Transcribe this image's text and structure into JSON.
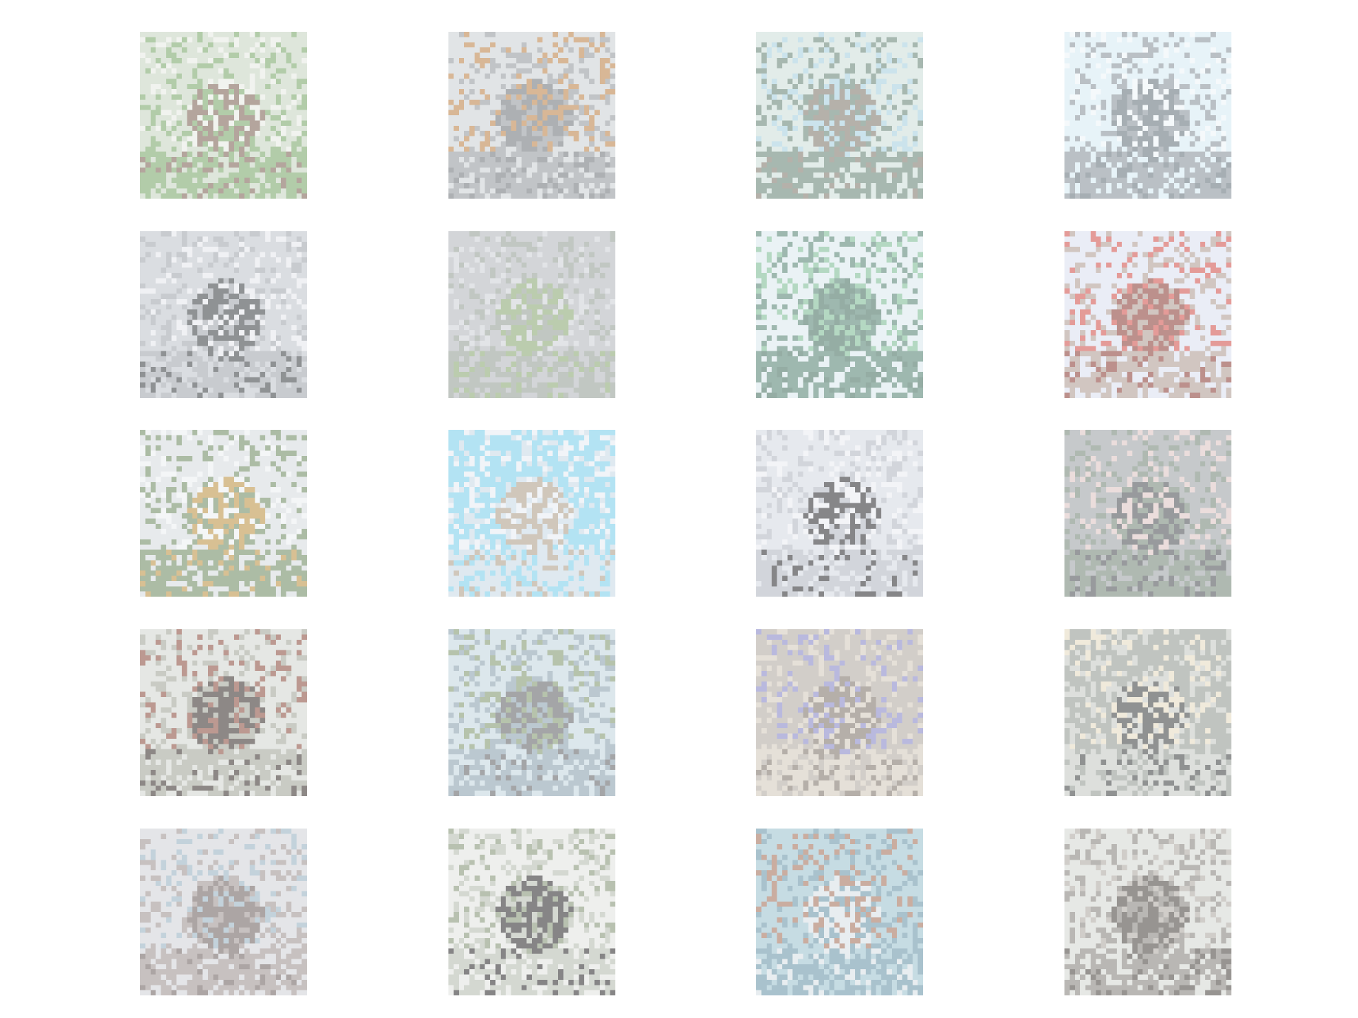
{
  "grid": {
    "rows": 5,
    "cols": 4,
    "images": [
      {
        "id": "img-r1c1",
        "subject": "deer",
        "colors": {
          "bg": "#c9d7c3",
          "mid": "#7fae6d",
          "fg": "#8a6f5e",
          "accent": "#e9ece6"
        }
      },
      {
        "id": "img-r1c2",
        "subject": "frog",
        "colors": {
          "bg": "#cfd3d8",
          "mid": "#9aa0a6",
          "fg": "#7b8087",
          "accent": "#c98a4b"
        }
      },
      {
        "id": "img-r1c3",
        "subject": "animal-by-water",
        "colors": {
          "bg": "#cfe0dc",
          "mid": "#6f8e7e",
          "fg": "#8a8274",
          "accent": "#a7d4e4"
        }
      },
      {
        "id": "img-r1c4",
        "subject": "bird",
        "colors": {
          "bg": "#d6ecf6",
          "mid": "#8e9aa4",
          "fg": "#6f7c87",
          "accent": "#eef5f8"
        }
      },
      {
        "id": "img-r2c1",
        "subject": "truck",
        "colors": {
          "bg": "#c4c8d0",
          "mid": "#a7abb3",
          "fg": "#4b4f55",
          "accent": "#e7e9ed"
        }
      },
      {
        "id": "img-r2c2",
        "subject": "frog",
        "colors": {
          "bg": "#b9bcc2",
          "mid": "#9aa59b",
          "fg": "#8fae77",
          "accent": "#d0d3d8"
        }
      },
      {
        "id": "img-r2c3",
        "subject": "ship",
        "colors": {
          "bg": "#dbeaf0",
          "mid": "#5c8f7f",
          "fg": "#4f7d6b",
          "accent": "#7fc49a"
        }
      },
      {
        "id": "img-r2c4",
        "subject": "airplane",
        "colors": {
          "bg": "#dde3f3",
          "mid": "#b7a39a",
          "fg": "#9d4a43",
          "accent": "#e45a55"
        }
      },
      {
        "id": "img-r3c1",
        "subject": "automobile",
        "colors": {
          "bg": "#d9dde2",
          "mid": "#76956a",
          "fg": "#c79a45",
          "accent": "#eef0f2"
        }
      },
      {
        "id": "img-r3c2",
        "subject": "airplane",
        "colors": {
          "bg": "#79d6f3",
          "mid": "#c9dbe8",
          "fg": "#b5a58f",
          "accent": "#e7eef5"
        }
      },
      {
        "id": "img-r3c3",
        "subject": "bird",
        "colors": {
          "bg": "#d7dce5",
          "mid": "#b5bcc7",
          "fg": "#3c3d40",
          "accent": "#eceef3"
        }
      },
      {
        "id": "img-r3c4",
        "subject": "ship",
        "colors": {
          "bg": "#a4a8ad",
          "mid": "#7c8f80",
          "fg": "#5a5d61",
          "accent": "#e3c9c5"
        }
      },
      {
        "id": "img-r4c1",
        "subject": "bird",
        "colors": {
          "bg": "#d5d8d4",
          "mid": "#a8ab9f",
          "fg": "#4a3f3b",
          "accent": "#9b5a4a"
        }
      },
      {
        "id": "img-r4c2",
        "subject": "deer",
        "colors": {
          "bg": "#c3d8e3",
          "mid": "#8fa7b6",
          "fg": "#6c6f72",
          "accent": "#86a174"
        }
      },
      {
        "id": "img-r4c3",
        "subject": "frog",
        "colors": {
          "bg": "#b9b1a6",
          "mid": "#d7cdbf",
          "fg": "#8a7f73",
          "accent": "#8e8fd4"
        }
      },
      {
        "id": "img-r4c4",
        "subject": "cat",
        "colors": {
          "bg": "#9aa19a",
          "mid": "#c9ccc7",
          "fg": "#4c5050",
          "accent": "#e9ddc0"
        }
      },
      {
        "id": "img-r5c1",
        "subject": "ship",
        "colors": {
          "bg": "#d4d6dc",
          "mid": "#a79b9a",
          "fg": "#7b6f6c",
          "accent": "#9cb7c9"
        }
      },
      {
        "id": "img-r5c2",
        "subject": "horse",
        "colors": {
          "bg": "#e4e6e3",
          "mid": "#b9c0b3",
          "fg": "#3c3a3d",
          "accent": "#8c9d7b"
        }
      },
      {
        "id": "img-r5c3",
        "subject": "ship",
        "colors": {
          "bg": "#9fc8d6",
          "mid": "#6f9fb4",
          "fg": "#d9e2e8",
          "accent": "#b07961"
        }
      },
      {
        "id": "img-r5c4",
        "subject": "frog",
        "colors": {
          "bg": "#d7dad6",
          "mid": "#8f8b85",
          "fg": "#5a534d",
          "accent": "#b3aea6"
        }
      }
    ]
  }
}
